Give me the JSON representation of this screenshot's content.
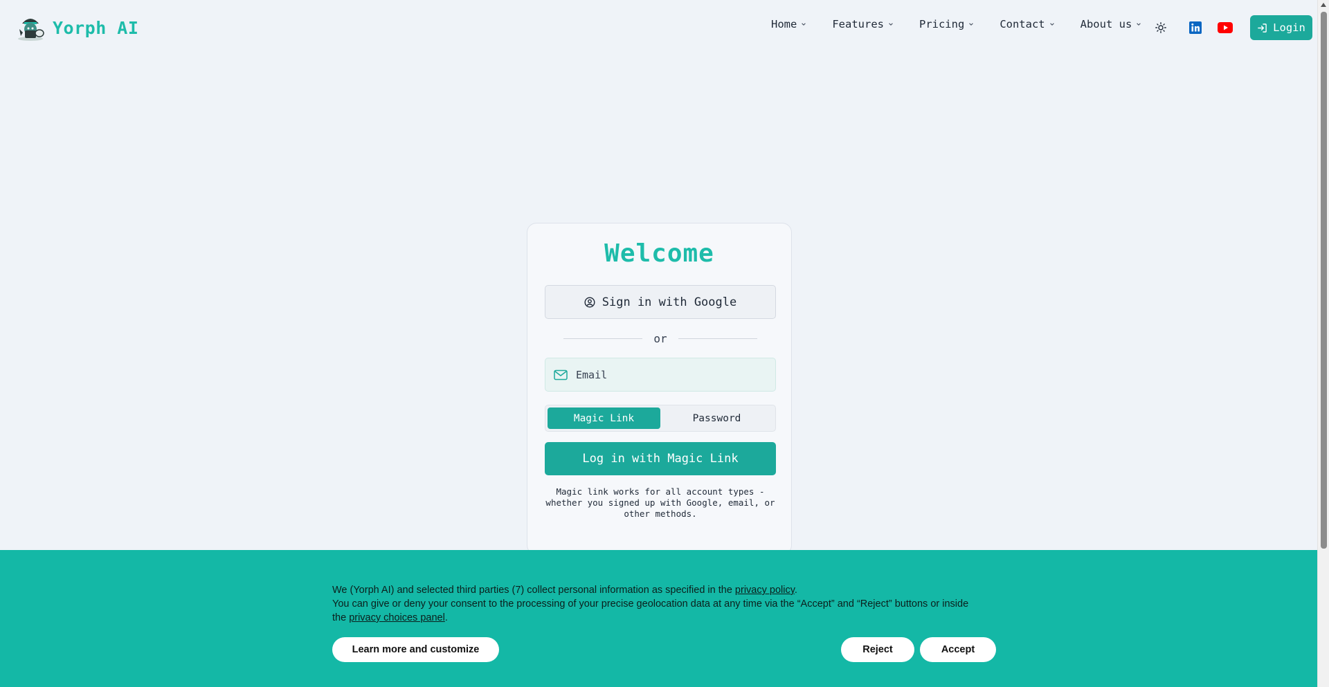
{
  "brand": {
    "name": "Yorph AI"
  },
  "nav": {
    "items": [
      {
        "label": "Home"
      },
      {
        "label": "Features"
      },
      {
        "label": "Pricing"
      },
      {
        "label": "Contact"
      },
      {
        "label": "About us"
      }
    ],
    "icons": [
      "theme-toggle-icon",
      "linkedin-icon",
      "youtube-icon"
    ],
    "login_label": "Login"
  },
  "card": {
    "title": "Welcome",
    "google_label": "Sign in with Google",
    "or_label": "or",
    "email_placeholder": "Email",
    "toggle": {
      "magic_label": "Magic Link",
      "password_label": "Password",
      "selected": "Magic Link"
    },
    "submit_label": "Log in with Magic Link",
    "hint": "Magic link works for all account types - whether you signed up with Google, email, or other methods."
  },
  "cookie": {
    "line1_prefix": "We (Yorph AI) and selected third parties (7) collect personal information as specified in the ",
    "line1_link": "privacy policy",
    "line1_suffix": ".",
    "line2": "You can give or deny your consent to the processing of your precise geolocation data at any time via the “Accept” and “Reject” buttons or inside the ",
    "line2_link": "privacy choices panel",
    "line2_suffix": ".",
    "learn_more_label": "Learn more and customize",
    "reject_label": "Reject",
    "accept_label": "Accept"
  },
  "colors": {
    "accent": "#1ca99b",
    "brand_text": "#1ebcaa",
    "banner": "#14b8a6",
    "background": "#eff3f8",
    "linkedin": "#0a66c2",
    "youtube": "#ff0000"
  }
}
